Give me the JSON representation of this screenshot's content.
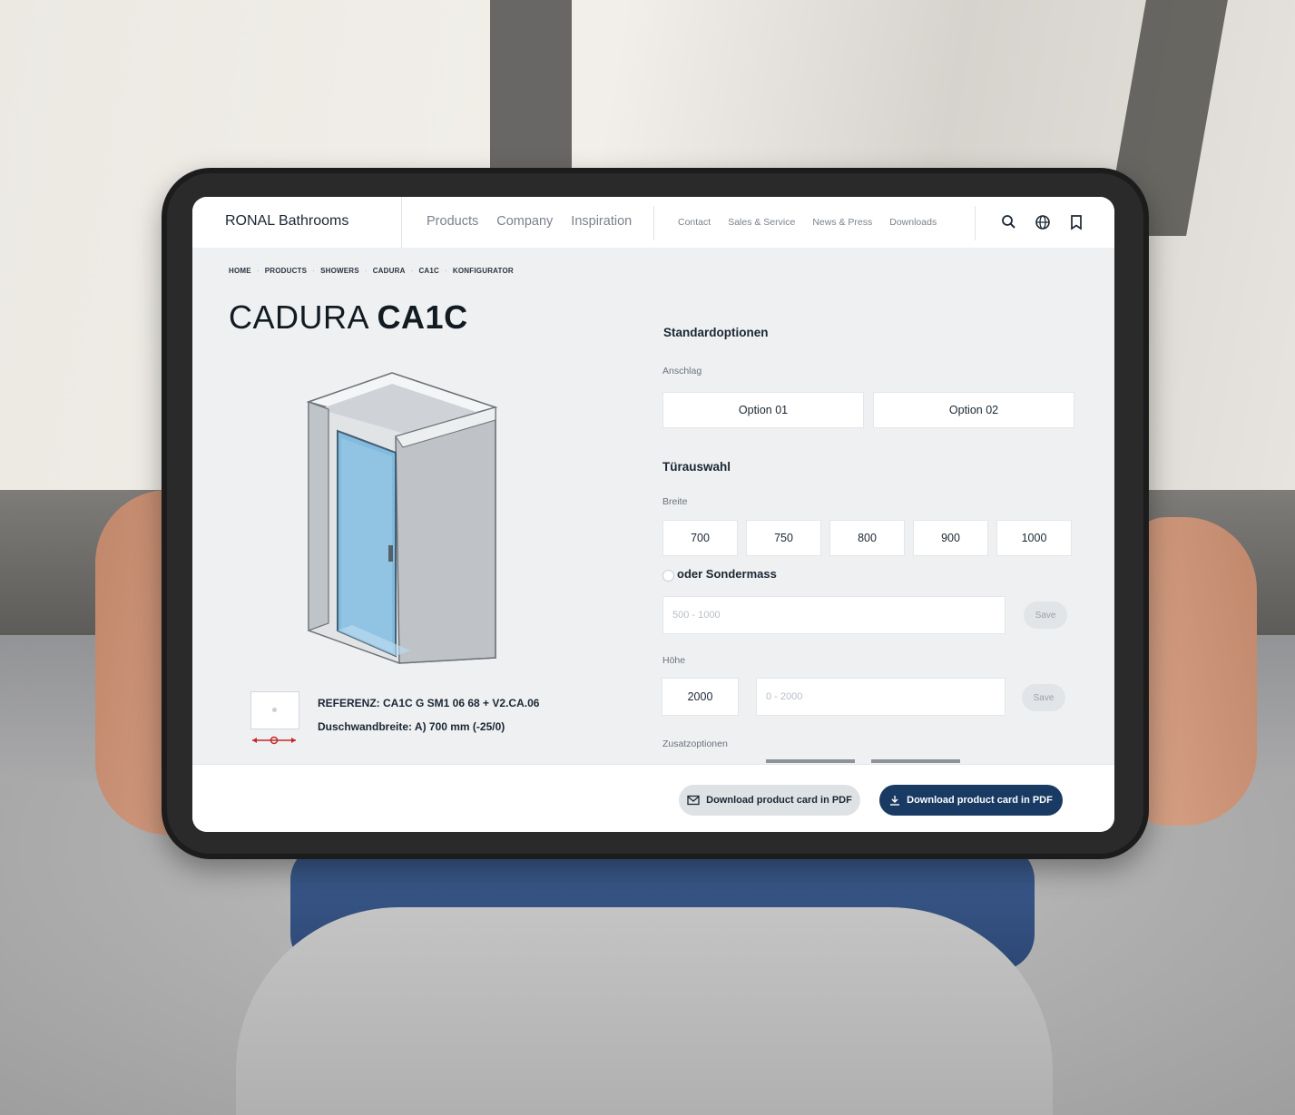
{
  "header": {
    "brand": "RONAL Bathrooms",
    "nav_main": [
      "Products",
      "Company",
      "Inspiration"
    ],
    "nav_secondary": [
      "Contact",
      "Sales & Service",
      "News & Press",
      "Downloads"
    ],
    "icons": [
      "search-icon",
      "globe-icon",
      "bookmark-icon"
    ]
  },
  "breadcrumb": [
    "HOME",
    "PRODUCTS",
    "SHOWERS",
    "CADURA",
    "CA1C",
    "KONFIGURATOR"
  ],
  "page_title": {
    "light": "CADURA",
    "bold": "CA1C"
  },
  "reference": {
    "line1": "REFERENZ: CA1C G SM1 06 68 + V2.CA.06",
    "line2": "Duschwandbreite: A) 700 mm (-25/0)"
  },
  "config": {
    "standard_title": "Standardoptionen",
    "anschlag_label": "Anschlag",
    "anschlag_options": [
      "Option 01",
      "Option 02"
    ],
    "door_title": "Türauswahl",
    "breite_label": "Breite",
    "breite_options": [
      "700",
      "750",
      "800",
      "900",
      "1000"
    ],
    "custom_label": "oder Sondermass",
    "custom_placeholder": "500 - 1000",
    "save_label": "Save",
    "hoehe_label": "Höhe",
    "hoehe_value": "2000",
    "hoehe_placeholder": "0 - 2000",
    "extra_title": "Zusatzoptionen"
  },
  "footer": {
    "btn_secondary": "Download product card in PDF",
    "btn_primary": "Download product card in PDF"
  },
  "colors": {
    "navy": "#183a63",
    "glass": "#7fb9de",
    "panel_bg": "#eef0f2"
  }
}
